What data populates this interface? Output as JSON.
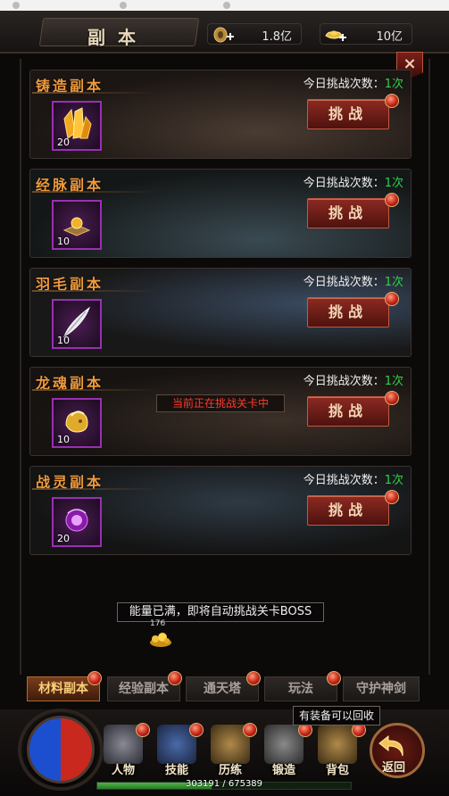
{
  "header": {
    "title": "副本",
    "copper_value": "1.8亿",
    "gold_value": "10亿",
    "close_symbol": "×"
  },
  "dungeons": [
    {
      "name": "铸造副本",
      "count_label": "今日挑战次数：",
      "count_value": "1次",
      "button": "挑战",
      "item_qty": "20",
      "item_icon": "gold-crystal-icon"
    },
    {
      "name": "经脉副本",
      "count_label": "今日挑战次数：",
      "count_value": "1次",
      "button": "挑战",
      "item_qty": "10",
      "item_icon": "golden-orb-icon"
    },
    {
      "name": "羽毛副本",
      "count_label": "今日挑战次数：",
      "count_value": "1次",
      "button": "挑战",
      "item_qty": "10",
      "item_icon": "white-feather-icon"
    },
    {
      "name": "龙魂副本",
      "count_label": "今日挑战次数：",
      "count_value": "1次",
      "button": "挑战",
      "item_qty": "10",
      "item_icon": "golden-dragon-soul-icon"
    },
    {
      "name": "战灵副本",
      "count_label": "今日挑战次数：",
      "count_value": "1次",
      "button": "挑战",
      "item_qty": "20",
      "item_icon": "purple-spirit-orb-icon"
    }
  ],
  "status_message": "当前正在挑战关卡中",
  "energy_message": "能量已满，即将自动挑战关卡BOSS",
  "gold_pile_count": "176",
  "tabs": [
    "材料副本",
    "经验副本",
    "通天塔",
    "玩法",
    "守护神剑"
  ],
  "active_tab": "材料副本",
  "recycle_notice": "有装备可以回收",
  "dock": [
    "人物",
    "技能",
    "历练",
    "锻造",
    "背包"
  ],
  "back_label": "返回",
  "exp": {
    "text": "303191 / 675389",
    "fraction": 0.449
  },
  "colors": {
    "accent_orange": "#ef9a3c",
    "count_green": "#2fd34a",
    "button_red": "#8c2a22",
    "warning_red": "#ff3b2f"
  }
}
